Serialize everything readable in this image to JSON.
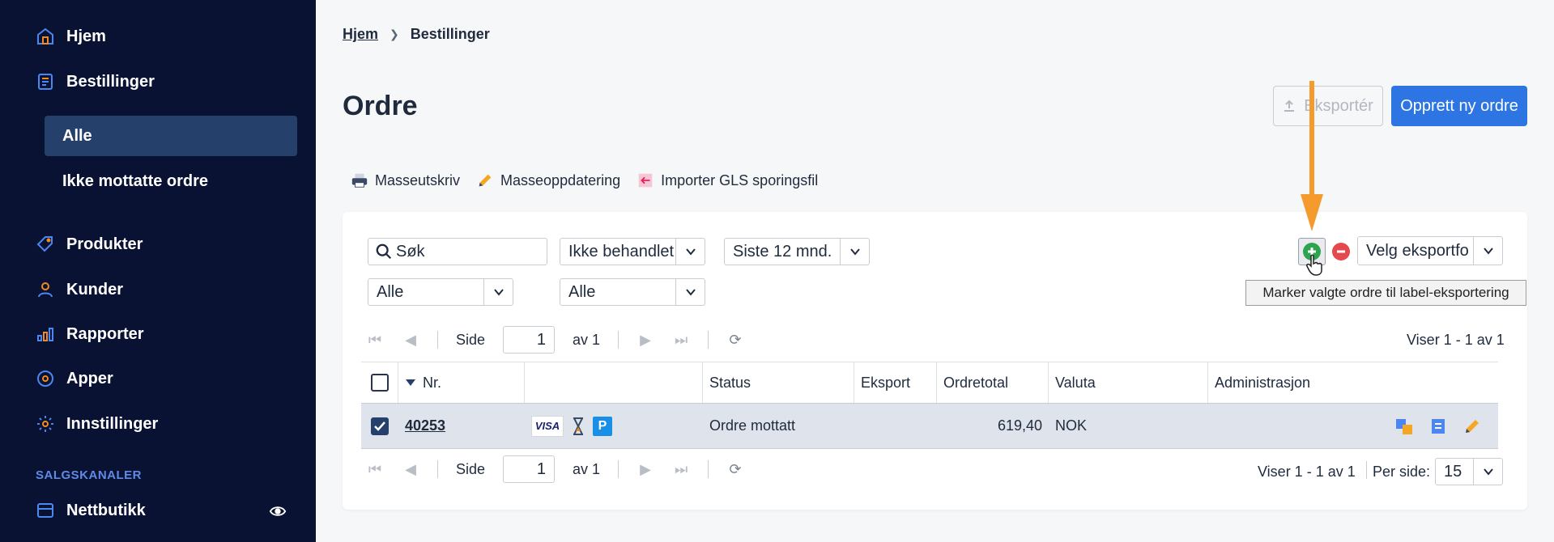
{
  "sidebar": {
    "items": [
      {
        "label": "Hjem",
        "icon": "home-icon"
      },
      {
        "label": "Bestillinger",
        "icon": "orders-icon"
      },
      {
        "label": "Produkter",
        "icon": "tag-icon"
      },
      {
        "label": "Kunder",
        "icon": "user-icon"
      },
      {
        "label": "Rapporter",
        "icon": "bar-chart-icon"
      },
      {
        "label": "Apper",
        "icon": "apps-icon"
      },
      {
        "label": "Innstillinger",
        "icon": "gear-icon"
      }
    ],
    "sub_items": [
      {
        "label": "Alle",
        "active": true
      },
      {
        "label": "Ikke mottatte ordre",
        "active": false
      }
    ],
    "section_label": "SALGSKANALER",
    "channel": {
      "label": "Nettbutikk",
      "icon": "store-icon"
    },
    "accent": "#f08a24"
  },
  "breadcrumb": {
    "home": "Hjem",
    "current": "Bestillinger"
  },
  "page_title": "Ordre",
  "header_buttons": {
    "export": "Eksportér",
    "new_order": "Opprett ny ordre"
  },
  "toolbar": {
    "mass_print": "Masseutskriv",
    "mass_update": "Masseoppdatering",
    "import_gls": "Importer GLS sporingsfil"
  },
  "filters": {
    "search_value": "Søk",
    "status": "Ikke behandlet",
    "period": "Siste 12 mnd.",
    "filter_a": "Alle",
    "filter_b": "Alle",
    "export_format": "Velg eksportfo"
  },
  "tooltip": "Marker valgte ordre til label-eksportering",
  "pager": {
    "side": "Side",
    "page": "1",
    "of": "av 1",
    "viser": "Viser 1 - 1 av 1",
    "per_side_label": "Per side:",
    "per_side_value": "15"
  },
  "table": {
    "headers": [
      "Nr.",
      "",
      "Status",
      "Eksport",
      "Ordretotal",
      "Valuta",
      "Administrasjon"
    ],
    "rows": [
      {
        "nr": "40253",
        "payment": "VISA",
        "status": "Ordre mottatt",
        "eksport": "",
        "total": "619,40",
        "valuta": "NOK"
      }
    ]
  },
  "colors": {
    "primary": "#2d75e3",
    "sidebar_bg": "#0a1233",
    "arrow": "#f59a2c",
    "add_green": "#2ea44f",
    "remove_red": "#e5484d"
  }
}
